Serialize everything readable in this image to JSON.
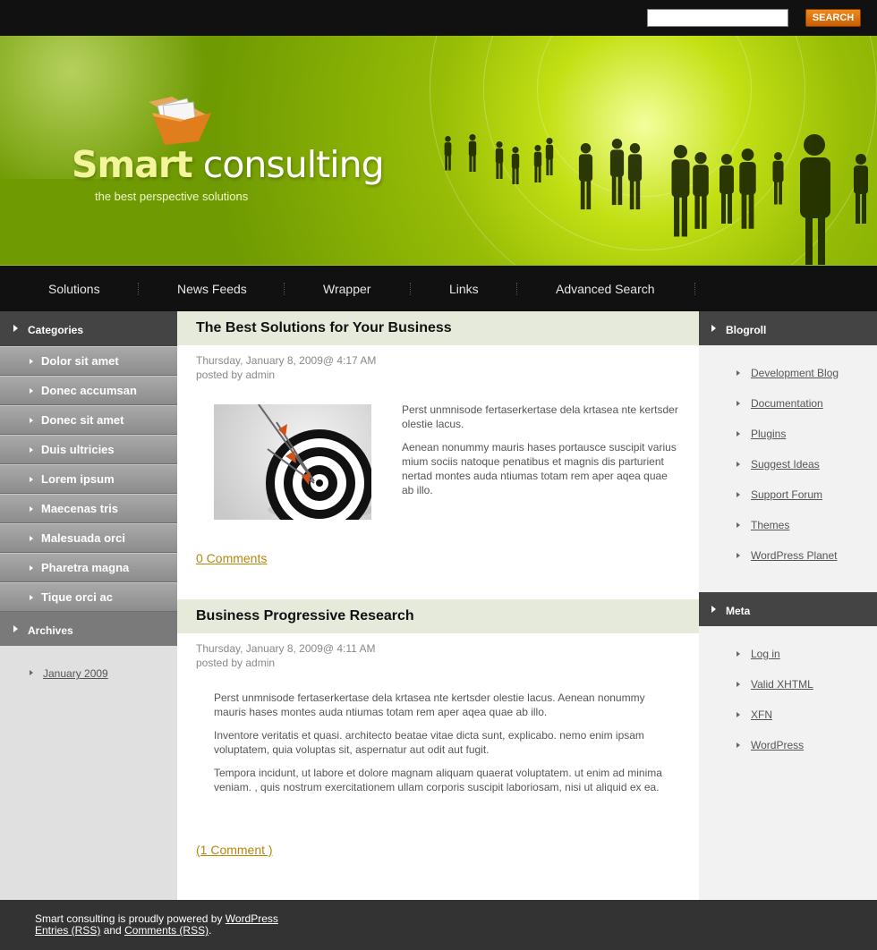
{
  "search": {
    "placeholder": "",
    "button_label": "SEARCH"
  },
  "banner": {
    "logo_bold": "Smart",
    "logo_rest": " consulting",
    "tagline": "the best perspective solutions"
  },
  "nav": {
    "items": [
      "Solutions",
      "News Feeds",
      "Wrapper",
      "Links",
      "Advanced Search"
    ]
  },
  "left_sidebar": {
    "categories_title": "Categories",
    "categories": [
      "Dolor sit amet",
      "Donec accumsan",
      "Donec sit amet",
      "Duis ultricies",
      "Lorem ipsum",
      "Maecenas tris",
      "Malesuada orci",
      "Pharetra magna",
      "Tique orci ac"
    ],
    "archives_title": "Archives",
    "archives": [
      "January 2009"
    ]
  },
  "posts": [
    {
      "title": "The Best Solutions for Your Business",
      "date": "Thursday, January 8, 2009@ 4:17 AM",
      "author": "posted by admin",
      "paragraphs": [
        "Perst unmnisode fertaserkertase dela krtasea nte kertsder olestie lacus.",
        "Aenean nonummy mauris hases portausce suscipit varius mium sociis natoque penatibus et magnis dis parturient nertad montes auda ntiumas totam rem aper aqea quae ab illo."
      ],
      "comments": "0 Comments"
    },
    {
      "title": "Business Progressive Research",
      "date": "Thursday, January 8, 2009@ 4:11 AM",
      "author": "posted by admin",
      "paragraphs": [
        "Perst unmnisode fertaserkertase dela krtasea nte kertsder olestie lacus. Aenean nonummy mauris hases montes auda ntiumas totam rem aper aqea quae ab illo.",
        "Inventore veritatis et quasi. architecto beatae vitae dicta sunt, explicabo. nemo enim ipsam voluptatem, quia voluptas sit, aspernatur aut odit aut fugit.",
        "Tempora incidunt, ut labore et dolore magnam aliquam quaerat voluptatem. ut enim ad minima veniam. , quis nostrum exercitationem ullam corporis suscipit laboriosam, nisi ut aliquid ex ea."
      ],
      "comments": "(1 Comment )"
    }
  ],
  "right_sidebar": {
    "blogroll_title": "Blogroll",
    "blogroll": [
      "Development Blog",
      "Documentation",
      "Plugins",
      "Suggest Ideas",
      "Support Forum",
      "Themes",
      "WordPress Planet"
    ],
    "meta_title": "Meta",
    "meta": [
      "Log in",
      "Valid XHTML",
      "XFN",
      "WordPress"
    ]
  },
  "footer": {
    "line1_text": "Smart consulting is proudly powered by ",
    "line1_link": "WordPress",
    "entries_link": "Entries (RSS)",
    "and_text": " and ",
    "comments_link": "Comments (RSS)",
    "end_text": "."
  },
  "colors": {
    "banner_green": "#97bd06",
    "search_orange": "#e07a10",
    "link_gold": "#b8860b",
    "post_title_bg": "#e6eadb"
  }
}
